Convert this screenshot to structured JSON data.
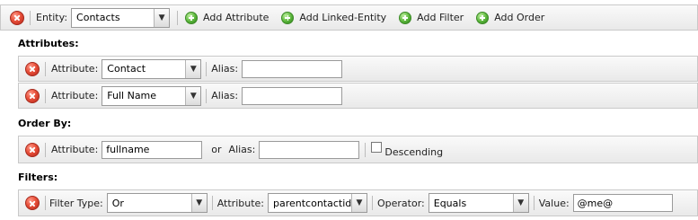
{
  "toolbar": {
    "entity_label": "Entity:",
    "entity_value": "Contacts",
    "add_attribute": "Add Attribute",
    "add_linked_entity": "Add Linked-Entity",
    "add_filter": "Add Filter",
    "add_order": "Add Order"
  },
  "attributes": {
    "heading": "Attributes:",
    "rows": [
      {
        "attribute_label": "Attribute:",
        "attribute_value": "Contact",
        "alias_label": "Alias:",
        "alias_value": ""
      },
      {
        "attribute_label": "Attribute:",
        "attribute_value": "Full Name",
        "alias_label": "Alias:",
        "alias_value": ""
      }
    ]
  },
  "order_by": {
    "heading": "Order By:",
    "attribute_label": "Attribute:",
    "attribute_value": "fullname",
    "or_label": "or",
    "alias_label": "Alias:",
    "alias_value": "",
    "descending_label": "Descending",
    "descending_checked": false
  },
  "filters": {
    "heading": "Filters:",
    "filter_type_label": "Filter Type:",
    "filter_type_value": "Or",
    "attribute_label": "Attribute:",
    "attribute_value": "parentcontactid",
    "operator_label": "Operator:",
    "operator_value": "Equals",
    "value_label": "Value:",
    "value_value": "@me@"
  },
  "icons": {
    "delete": "delete-x-icon",
    "add": "add-plus-icon",
    "dropdown": "chevron-down-icon"
  },
  "colors": {
    "delete_red": "#e8503a",
    "add_green": "#59b53a",
    "bar_bg": "#eeeeee"
  }
}
